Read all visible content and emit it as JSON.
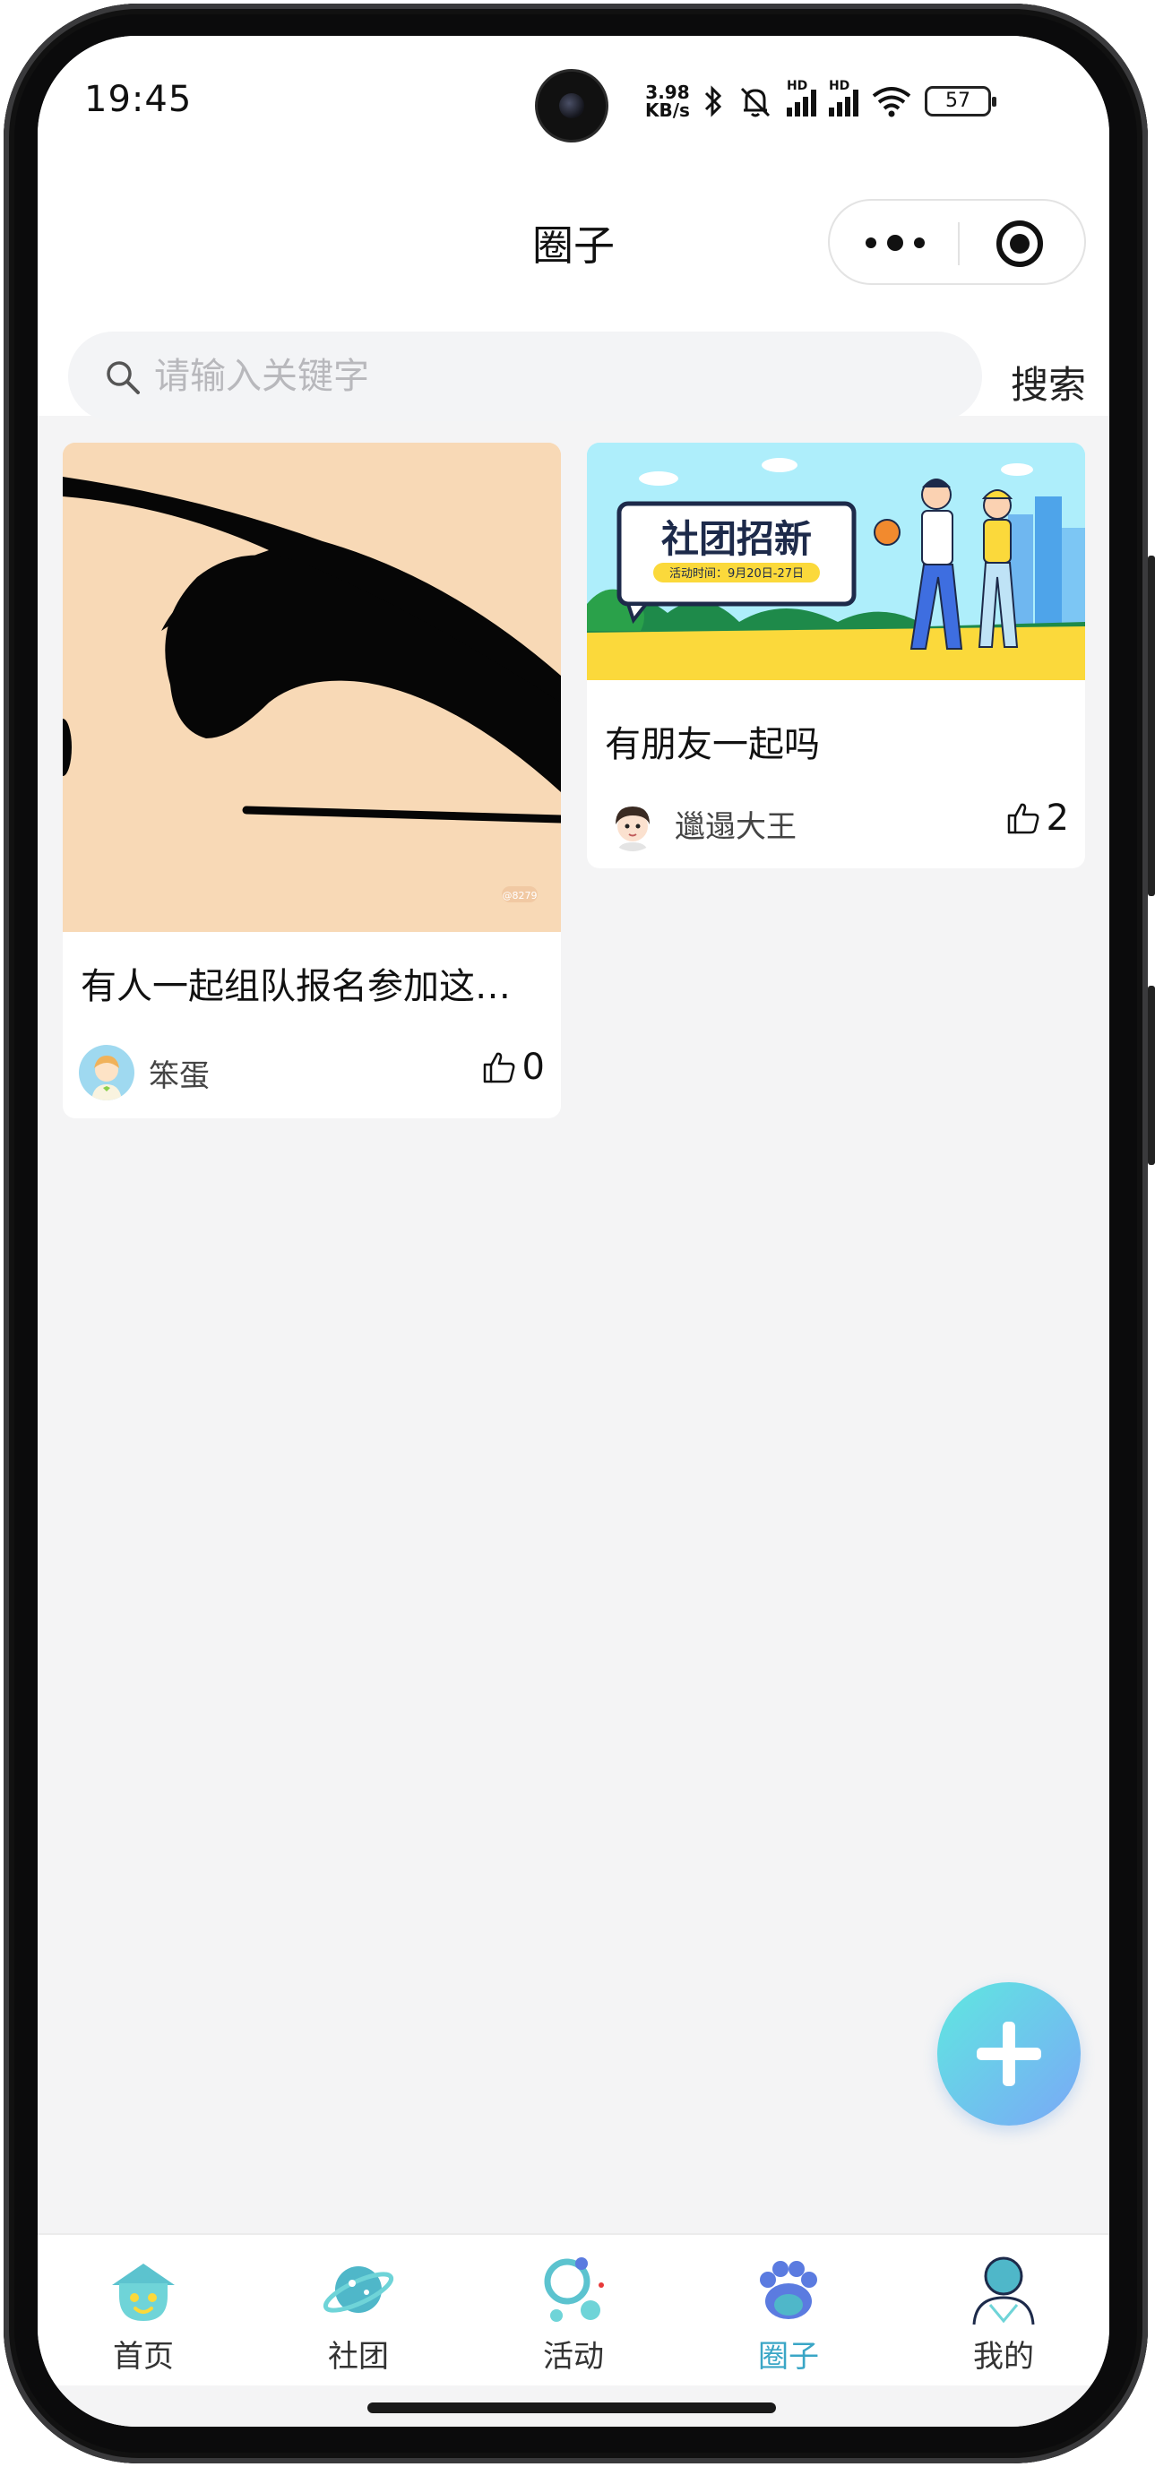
{
  "status_bar": {
    "time": "19:45",
    "net_speed_value": "3.98",
    "net_speed_unit": "KB/s",
    "battery": "57",
    "icons": [
      "bluetooth-icon",
      "mute-icon",
      "hd-signal-icon",
      "hd-signal-icon",
      "wifi-icon",
      "battery-icon"
    ]
  },
  "nav": {
    "title": "圈子",
    "capsule": [
      "more-icon",
      "target-icon"
    ]
  },
  "search": {
    "placeholder": "请输入关键字",
    "button_label": "搜索"
  },
  "feed": {
    "posts": [
      {
        "title": "有人一起组队报名参加这…",
        "author": "笨蛋",
        "likes": "0",
        "watermark": "@8279"
      },
      {
        "title": "有朋友一起吗",
        "author": "邋遢大王",
        "likes": "2",
        "banner_heading": "社团招新",
        "banner_sub": "活动时间：9月20日-27日"
      }
    ]
  },
  "fab": {
    "icon": "plus-icon"
  },
  "tabbar": {
    "active": "圈子",
    "active_color": "#3aa6c6",
    "tabs": [
      {
        "label": "首页",
        "icon": "home-icon"
      },
      {
        "label": "社团",
        "icon": "planet-icon"
      },
      {
        "label": "活动",
        "icon": "activity-icon"
      },
      {
        "label": "圈子",
        "icon": "paw-icon"
      },
      {
        "label": "我的",
        "icon": "user-icon"
      }
    ]
  }
}
